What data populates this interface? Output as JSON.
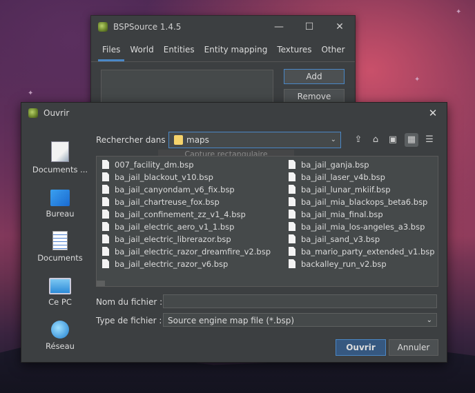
{
  "main_window": {
    "title": "BSPSource 1.4.5",
    "controls": {
      "minimize": "—",
      "maximize": "☐",
      "close": "✕"
    },
    "tabs": [
      "Files",
      "World",
      "Entities",
      "Entity mapping",
      "Textures",
      "Other"
    ],
    "active_tab": "Files",
    "buttons": {
      "add": "Add",
      "remove": "Remove"
    }
  },
  "dialog": {
    "title": "Ouvrir",
    "close": "✕",
    "places": [
      "Documents ...",
      "Bureau",
      "Documents",
      "Ce PC",
      "Réseau"
    ],
    "look_in_label": "Rechercher dans :",
    "look_in_value": "maps",
    "toolbar_icons": [
      "up-folder-icon",
      "home-icon",
      "new-folder-icon",
      "grid-view-icon",
      "list-view-icon"
    ],
    "ghost_text": "Capture rectangulaire",
    "files_col1": [
      "007_facility_dm.bsp",
      "ba_jail_blackout_v10.bsp",
      "ba_jail_canyondam_v6_fix.bsp",
      "ba_jail_chartreuse_fox.bsp",
      "ba_jail_confinement_zz_v1_4.bsp",
      "ba_jail_electric_aero_v1_1.bsp",
      "ba_jail_electric_librerazor.bsp",
      "ba_jail_electric_razor_dreamfire_v2.bsp",
      "ba_jail_electric_razor_v6.bsp"
    ],
    "files_col2": [
      "ba_jail_ganja.bsp",
      "ba_jail_laser_v4b.bsp",
      "ba_jail_lunar_mkiif.bsp",
      "ba_jail_mia_blackops_beta6.bsp",
      "ba_jail_mia_final.bsp",
      "ba_jail_mia_los-angeles_a3.bsp",
      "ba_jail_sand_v3.bsp",
      "ba_mario_party_extended_v1.bsp",
      "backalley_run_v2.bsp"
    ],
    "filename_label": "Nom du fichier :",
    "filename_value": "",
    "filetype_label": "Type de fichier :",
    "filetype_value": "Source engine map file (*.bsp)",
    "open_button": "Ouvrir",
    "cancel_button": "Annuler"
  }
}
